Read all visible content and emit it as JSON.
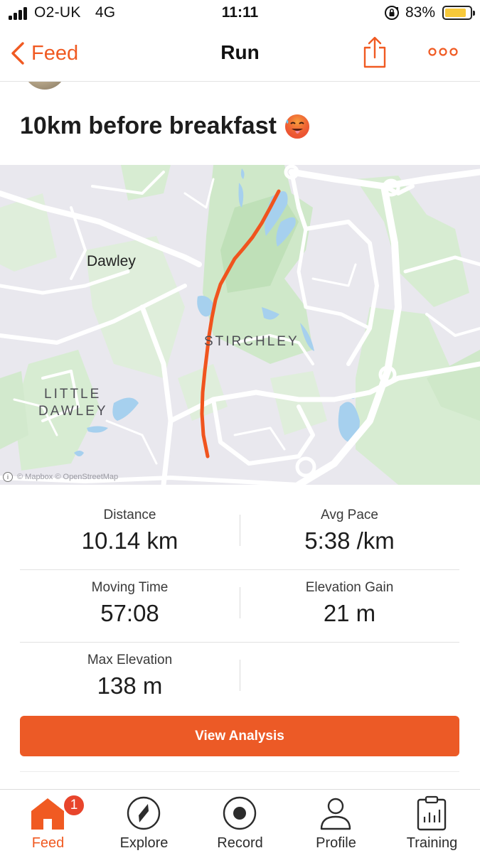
{
  "status_bar": {
    "carrier": "O2-UK",
    "network": "4G",
    "time": "11:11",
    "battery_percent": "83%",
    "battery_level": 0.83,
    "icons": [
      "signal-icon",
      "rotation-lock-icon",
      "battery-icon"
    ]
  },
  "nav": {
    "back_label": "Feed",
    "title": "Run",
    "icons": [
      "chevron-left-icon",
      "share-icon",
      "more-icon"
    ]
  },
  "activity": {
    "title": "10km before breakfast",
    "emoji_icon": "hot-face-emoji-icon"
  },
  "map": {
    "labels": {
      "dawley": "Dawley",
      "stirchley": "STIRCHLEY",
      "little": "LITTLE",
      "dawley_upper": "DAWLEY"
    },
    "attribution": "© Mapbox © OpenStreetMap",
    "route_color": "#f0541e"
  },
  "stats": {
    "distance": {
      "label": "Distance",
      "value": "10.14 km"
    },
    "avg_pace": {
      "label": "Avg Pace",
      "value": "5:38 /km"
    },
    "moving_time": {
      "label": "Moving Time",
      "value": "57:08"
    },
    "elevation_gain": {
      "label": "Elevation Gain",
      "value": "21 m"
    },
    "max_elevation": {
      "label": "Max Elevation",
      "value": "138 m"
    }
  },
  "actions": {
    "view_analysis": "View Analysis"
  },
  "tab_bar": {
    "feed": {
      "label": "Feed",
      "badge": "1",
      "icon": "home-icon"
    },
    "explore": {
      "label": "Explore",
      "icon": "compass-icon"
    },
    "record": {
      "label": "Record",
      "icon": "record-icon"
    },
    "profile": {
      "label": "Profile",
      "icon": "profile-icon"
    },
    "training": {
      "label": "Training",
      "icon": "training-icon"
    }
  },
  "colors": {
    "accent": "#f05a22",
    "button": "#ec5a26",
    "map_background": "#e9e8ee",
    "park_green": "#cfe8c9",
    "water_blue": "#a6d0ee"
  }
}
